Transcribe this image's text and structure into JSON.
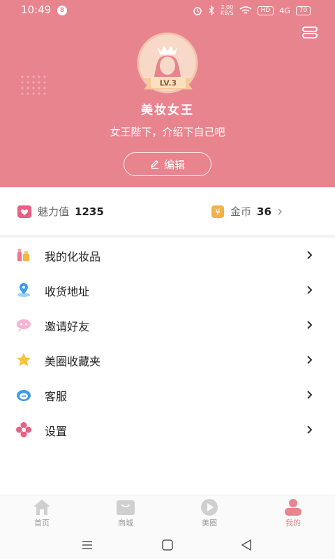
{
  "status_bar": {
    "time": "10:49",
    "notification_count": "8",
    "speed_value": "2.00",
    "speed_unit": "KB/S",
    "hd": "HD",
    "network": "4G",
    "battery": "70"
  },
  "profile": {
    "level": "LV.3",
    "username": "美妆女王",
    "bio": "女王陛下，介绍下自己吧",
    "edit_label": "编辑"
  },
  "stats": {
    "charm": {
      "label": "魅力值",
      "value": "1235"
    },
    "coins": {
      "icon_text": "¥",
      "label": "金币",
      "value": "36"
    }
  },
  "menu": {
    "items": [
      {
        "label": "我的化妆品",
        "icon": "cosmetics-icon"
      },
      {
        "label": "收货地址",
        "icon": "location-pin-icon"
      },
      {
        "label": "邀请好友",
        "icon": "invite-friends-icon"
      },
      {
        "label": "美圈收藏夹",
        "icon": "star-icon"
      },
      {
        "label": "客服",
        "icon": "headset-icon"
      },
      {
        "label": "设置",
        "icon": "flower-settings-icon"
      }
    ]
  },
  "bottom_nav": {
    "items": [
      {
        "label": "首页",
        "icon": "home-icon"
      },
      {
        "label": "商城",
        "icon": "shopping-bag-icon"
      },
      {
        "label": "美圈",
        "icon": "play-icon"
      },
      {
        "label": "我的",
        "icon": "profile-icon"
      }
    ],
    "active": "我的"
  },
  "colors": {
    "header_pink": "#e8848e",
    "accent_pink": "#e8848e",
    "coin_orange": "#f3b04c"
  }
}
